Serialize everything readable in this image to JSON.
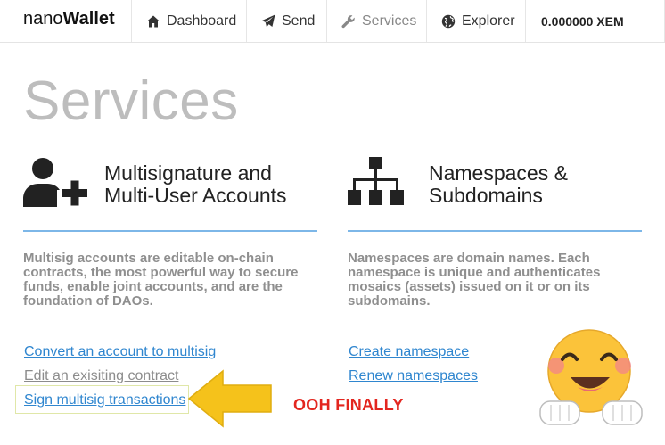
{
  "navbar": {
    "brand_prefix": "nano",
    "brand_suffix": "Wallet",
    "items": [
      {
        "label": "Dashboard",
        "icon": "home-icon"
      },
      {
        "label": "Send",
        "icon": "paper-plane-icon"
      },
      {
        "label": "Services",
        "icon": "wrench-icon"
      },
      {
        "label": "Explorer",
        "icon": "globe-icon"
      }
    ],
    "balance": "0.000000 XEM"
  },
  "page": {
    "title": "Services"
  },
  "services": [
    {
      "title_line1": "Multisignature and",
      "title_line2": "Multi-User Accounts",
      "icon": "user-plus-icon",
      "description": "Multisig accounts are editable on-chain contracts, the most powerful way to secure funds, enable joint accounts, and are the foundation of DAOs.",
      "links": [
        {
          "label": "Convert an account to multisig"
        },
        {
          "label": "Edit an exisiting contract"
        },
        {
          "label": "Sign multisig transactions"
        }
      ]
    },
    {
      "title_line1": "Namespaces &",
      "title_line2": "Subdomains",
      "icon": "sitemap-icon",
      "description": "Namespaces are domain names. Each namespace is unique and authenticates mosaics (assets) issued on it or on its subdomains.",
      "links": [
        {
          "label": "Create namespace"
        },
        {
          "label": "Renew namespaces"
        }
      ]
    }
  ],
  "annotation": {
    "text": "OOH FINALLY",
    "color": "#e3261f",
    "arrow_color": "#f5c21b",
    "emoji": "hugging-face-icon"
  },
  "colors": {
    "link": "#2f86cf",
    "rule": "#7db7e8",
    "title_gray": "#bdbdbd"
  }
}
